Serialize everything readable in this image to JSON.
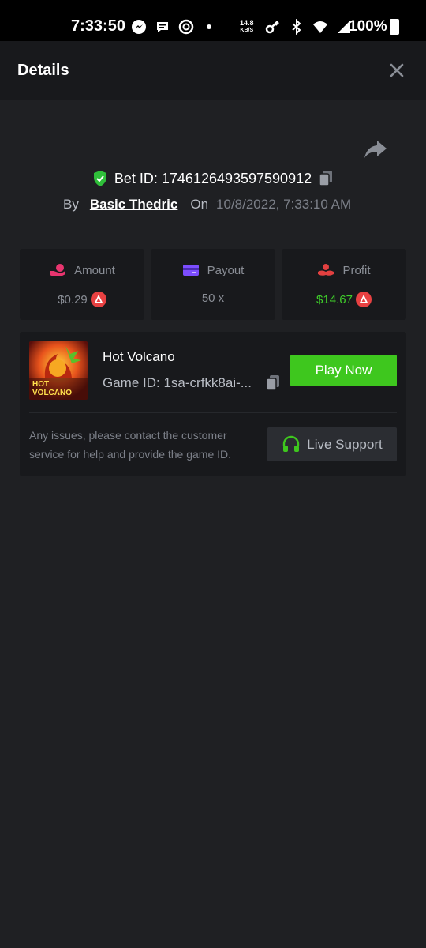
{
  "status_bar": {
    "time": "7:33:50",
    "net_speed": "14.8",
    "net_unit": "KB/S",
    "battery": "100%"
  },
  "header": {
    "title": "Details"
  },
  "bet": {
    "id_label": "Bet ID: 1746126493597590912",
    "by_label": "By",
    "user": "Basic Thedric",
    "on_label": "On",
    "date": "10/8/2022, 7:33:10 AM"
  },
  "stats": [
    {
      "label": "Amount",
      "value": "$0.29",
      "icon": "money-hand-icon",
      "color": "#e8356f"
    },
    {
      "label": "Payout",
      "value": "50 x",
      "icon": "card-icon",
      "color": "#7c4dff"
    },
    {
      "label": "Profit",
      "value": "$14.67",
      "icon": "profit-hand-icon",
      "color": "#e24040"
    }
  ],
  "game": {
    "name": "Hot Volcano",
    "game_id": "Game ID: 1sa-crfkk8ai-...",
    "play_label": "Play Now",
    "thumb_line1": "HOT",
    "thumb_line2": "VOLCANO"
  },
  "support": {
    "notice": "Any issues, please contact the customer service for help and provide the game ID.",
    "button_label": "Live Support"
  },
  "colors": {
    "accent_green": "#3ec71e",
    "background": "#1f2023",
    "card": "#18191c"
  }
}
